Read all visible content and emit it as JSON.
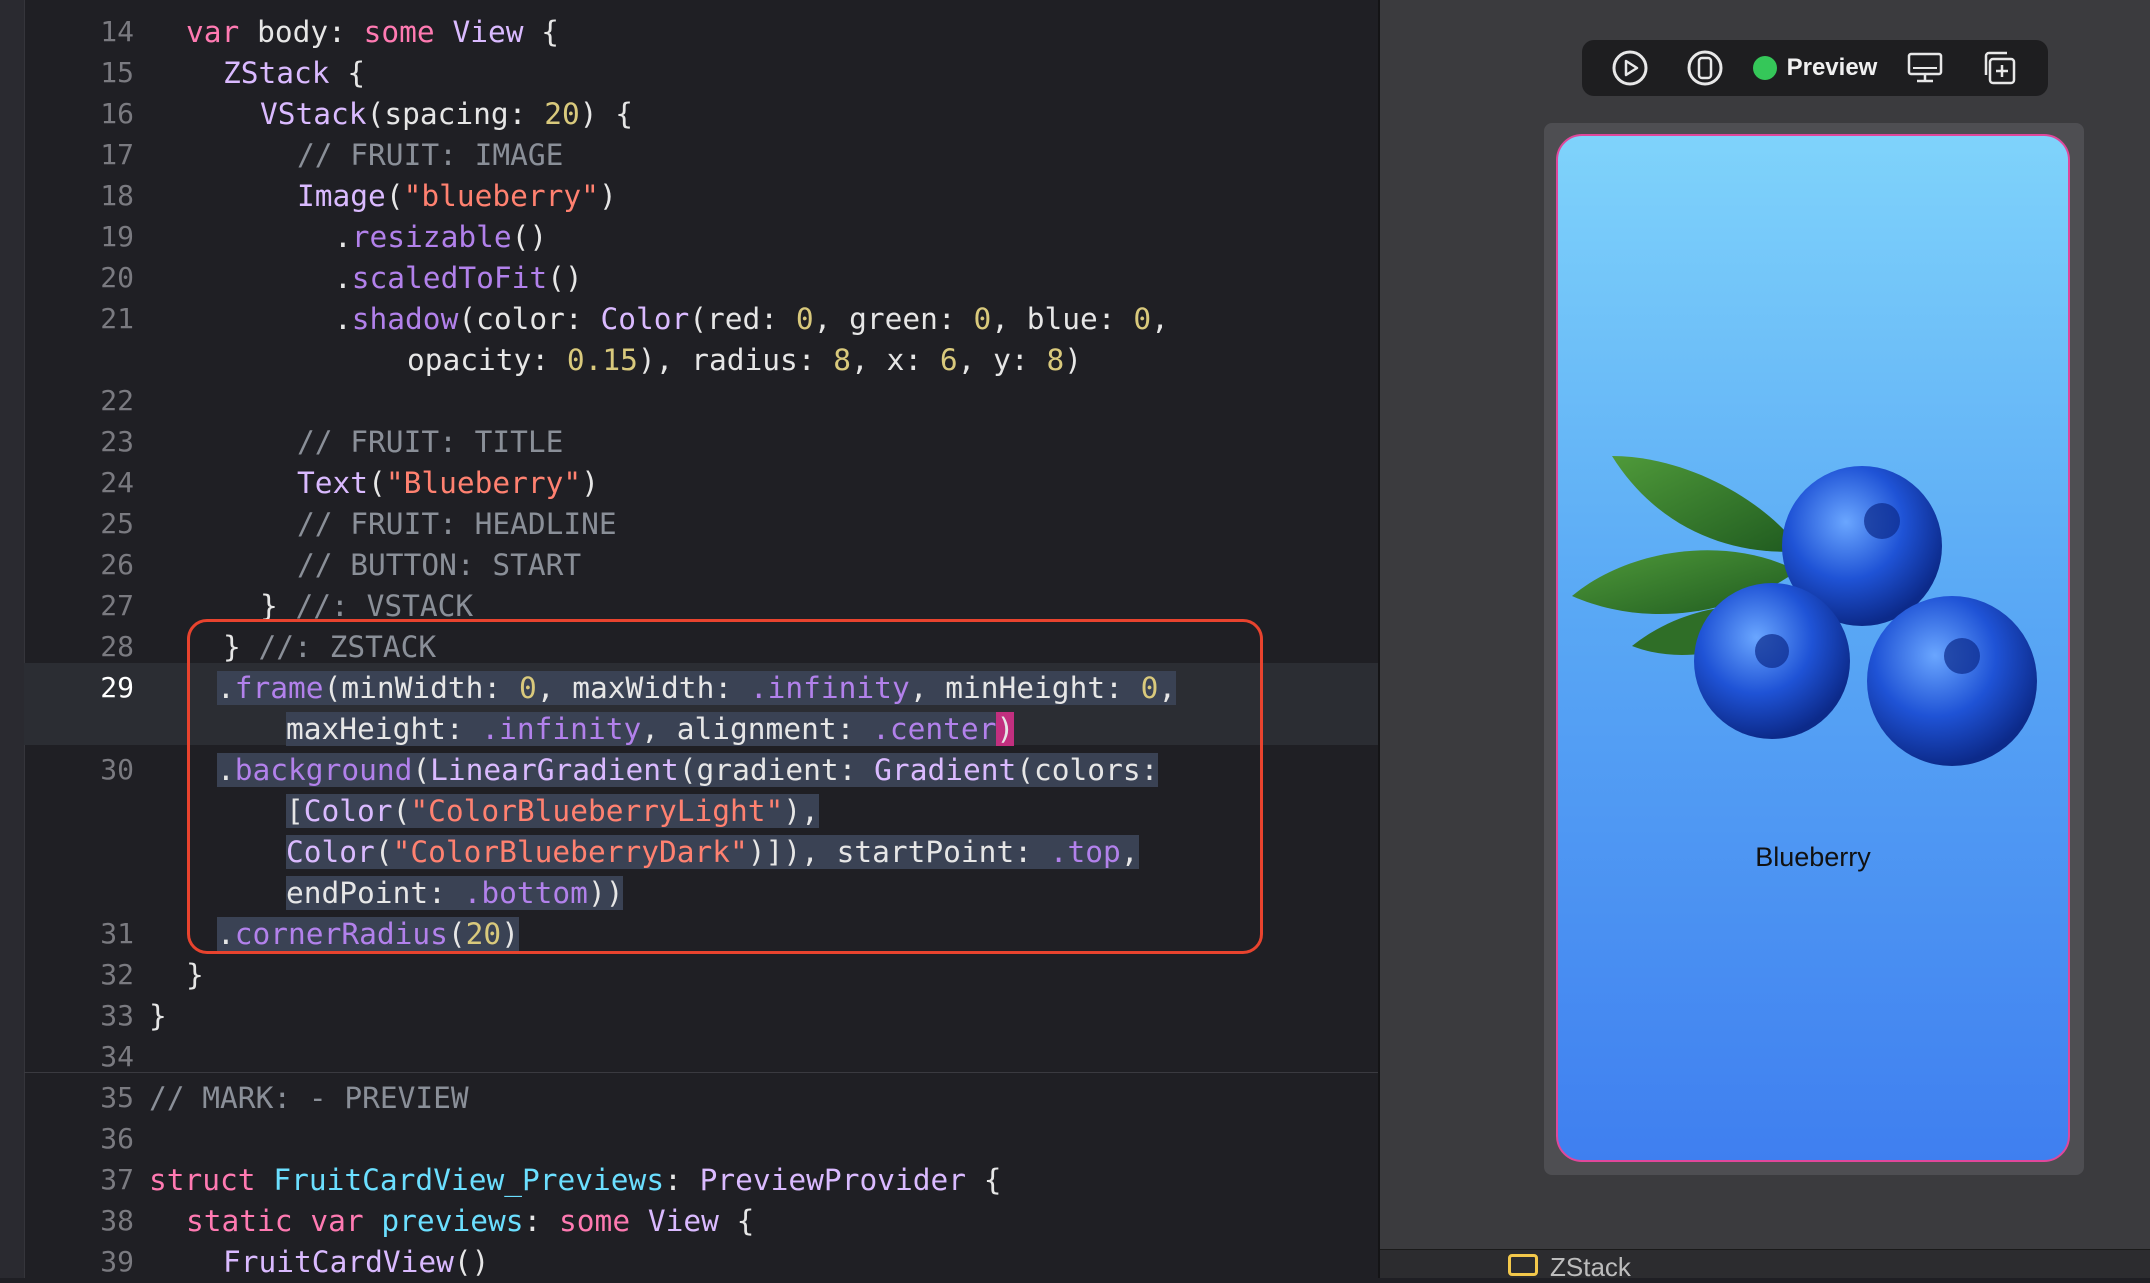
{
  "editor": {
    "line_numbers": [
      "14",
      "15",
      "16",
      "17",
      "18",
      "19",
      "20",
      "21",
      "22",
      "23",
      "24",
      "25",
      "26",
      "27",
      "28",
      "29",
      "30",
      "31",
      "32",
      "33",
      "34",
      "35",
      "36",
      "37",
      "38",
      "39"
    ],
    "current_line": "29",
    "code": {
      "l14": {
        "kw1": "var",
        "name": "body",
        "colon": ":",
        "kw2": "some",
        "type": "View",
        "brace": "{"
      },
      "l15": {
        "type": "ZStack",
        "brace": "{"
      },
      "l16": {
        "type": "VStack",
        "open": "(spacing: ",
        "num": "20",
        "close": ")",
        "brace": "{"
      },
      "l17": {
        "comment": "// FRUIT: IMAGE"
      },
      "l18": {
        "type": "Image",
        "open": "(",
        "str": "\"blueberry\"",
        "close": ")"
      },
      "l19": {
        "dot": ".",
        "method": "resizable",
        "parens": "()"
      },
      "l20": {
        "dot": ".",
        "method": "scaledToFit",
        "parens": "()"
      },
      "l21a": {
        "dot": ".",
        "method": "shadow",
        "a": "(color: ",
        "type": "Color",
        "b": "(red: ",
        "n1": "0",
        "c": ", green: ",
        "n2": "0",
        "d": ", blue: ",
        "n3": "0",
        "e": ","
      },
      "l21b": {
        "a": "opacity: ",
        "n1": "0.15",
        "b": "), radius: ",
        "n2": "8",
        "c": ", x: ",
        "n3": "6",
        "d": ", y: ",
        "n4": "8",
        "e": ")"
      },
      "l23": {
        "comment": "// FRUIT: TITLE"
      },
      "l24": {
        "type": "Text",
        "open": "(",
        "str": "\"Blueberry\"",
        "close": ")"
      },
      "l25": {
        "comment": "// FRUIT: HEADLINE"
      },
      "l26": {
        "comment": "// BUTTON: START"
      },
      "l27": {
        "brace": "}",
        "comment": " //: VSTACK"
      },
      "l28": {
        "brace": "}",
        "comment": " //: ZSTACK"
      },
      "l29a": {
        "dot": ".",
        "method": "frame",
        "a": "(minWidth: ",
        "n1": "0",
        "b": ", maxWidth: ",
        "p1": ".infinity",
        "c": ", minHeight: ",
        "n2": "0",
        "d": ","
      },
      "l29b": {
        "a": "maxHeight: ",
        "p1": ".infinity",
        "b": ", alignment: ",
        "p2": ".center",
        "caret": ")"
      },
      "l30a": {
        "dot": ".",
        "method": "background",
        "a": "(",
        "t1": "LinearGradient",
        "b": "(gradient: ",
        "t2": "Gradient",
        "c": "(colors:"
      },
      "l30b": {
        "a": "[",
        "t1": "Color",
        "b": "(",
        "str": "\"ColorBlueberryLight\"",
        "c": "),"
      },
      "l30c": {
        "t1": "Color",
        "a": "(",
        "str": "\"ColorBlueberryDark\"",
        "b": ")]), startPoint: ",
        "p1": ".top",
        "c": ","
      },
      "l30d": {
        "a": "endPoint: ",
        "p1": ".bottom",
        "b": "))"
      },
      "l31": {
        "dot": ".",
        "method": "cornerRadius",
        "a": "(",
        "num": "20",
        "b": ")"
      },
      "l32": {
        "brace": "}"
      },
      "l33": {
        "brace": "}"
      },
      "l35": {
        "comment": "// MARK: - PREVIEW"
      },
      "l37": {
        "kw": "struct",
        "name": "FruitCardView_Previews",
        "colon": ":",
        "proto": "PreviewProvider",
        "brace": "{"
      },
      "l38": {
        "kw1": "static",
        "kw2": "var",
        "name": "previews",
        "colon": ":",
        "kw3": "some",
        "type": "View",
        "brace": "{"
      },
      "l39": {
        "type": "FruitCardView",
        "parens": "()"
      }
    }
  },
  "preview": {
    "toolbar": {
      "play_icon": "play-circle-icon",
      "device_icon": "device-icon",
      "toggle_label": "Preview",
      "display_icon": "display-icon",
      "duplicate_icon": "duplicate-icon"
    },
    "card": {
      "title": "Blueberry",
      "gradient_top": "#7fd3fb",
      "gradient_bottom": "#3f7ff0"
    },
    "bottom_bar": {
      "label": "ZStack"
    }
  },
  "colors": {
    "keyword": "#ff7ab2",
    "type": "#dabaff",
    "string": "#ff8170",
    "number": "#d9c97c",
    "comment": "#8a8f98",
    "highlight_box": "#e8432e",
    "preview_dot": "#35c759"
  }
}
